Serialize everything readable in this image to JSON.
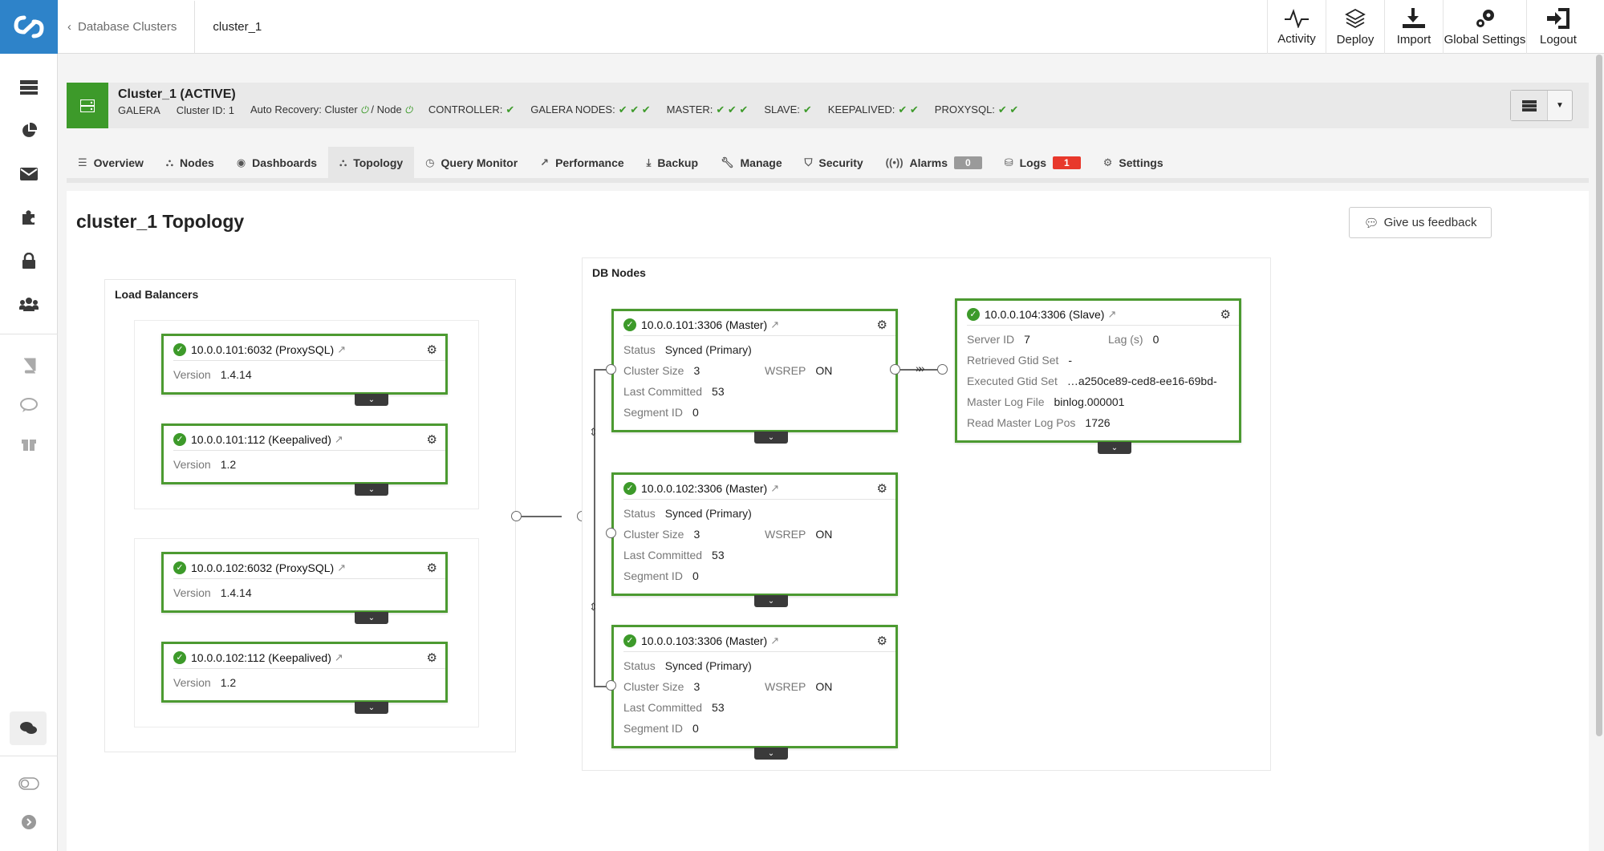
{
  "breadcrumb": {
    "back": "Database Clusters",
    "current": "cluster_1"
  },
  "toolbar": {
    "activity": "Activity",
    "deploy": "Deploy",
    "import": "Import",
    "global_settings": "Global Settings",
    "logout": "Logout"
  },
  "cluster": {
    "title": "Cluster_1 (ACTIVE)",
    "type": "GALERA",
    "cluster_id": "Cluster ID: 1",
    "auto_recovery": "Auto Recovery: Cluster",
    "node_sep": "/ Node",
    "controller": "CONTROLLER:",
    "galera_nodes": "GALERA NODES:",
    "master": "MASTER:",
    "slave": "SLAVE:",
    "keepalived": "KEEPALIVED:",
    "proxysql": "PROXYSQL:",
    "check1": "✔",
    "check2": "✔ ✔",
    "check3": "✔ ✔ ✔"
  },
  "tabs": [
    {
      "label": "Overview",
      "icon": "list-icon"
    },
    {
      "label": "Nodes",
      "icon": "sitemap-icon"
    },
    {
      "label": "Dashboards",
      "icon": "dashboard-icon"
    },
    {
      "label": "Topology",
      "icon": "topology-icon"
    },
    {
      "label": "Query Monitor",
      "icon": "clock-icon"
    },
    {
      "label": "Performance",
      "icon": "line-chart-icon"
    },
    {
      "label": "Backup",
      "icon": "download-icon"
    },
    {
      "label": "Manage",
      "icon": "wrench-icon"
    },
    {
      "label": "Security",
      "icon": "shield-icon"
    },
    {
      "label": "Alarms",
      "badge": "0",
      "icon": "broadcast-icon"
    },
    {
      "label": "Logs",
      "badge": "1",
      "icon": "archive-icon"
    },
    {
      "label": "Settings",
      "icon": "gear-icon"
    }
  ],
  "badges": {
    "alarms_color": "#9a9a9a",
    "logs_color": "#e8382b"
  },
  "page": {
    "title": "cluster_1 Topology",
    "feedback": "Give us feedback"
  },
  "groups": {
    "lb": "Load Balancers",
    "db": "DB Nodes"
  },
  "lbs": [
    {
      "title": "10.0.0.101:6032 (ProxySQL)",
      "k": "Version",
      "v": "1.4.14"
    },
    {
      "title": "10.0.0.101:112 (Keepalived)",
      "k": "Version",
      "v": "1.2"
    },
    {
      "title": "10.0.0.102:6032 (ProxySQL)",
      "k": "Version",
      "v": "1.4.14"
    },
    {
      "title": "10.0.0.102:112 (Keepalived)",
      "k": "Version",
      "v": "1.2"
    }
  ],
  "masters": [
    {
      "title": "10.0.0.101:3306 (Master)",
      "status_k": "Status",
      "status_v": "Synced (Primary)",
      "size_k": "Cluster Size",
      "size_v": "3",
      "wsrep_k": "WSREP",
      "wsrep_v": "ON",
      "lc_k": "Last Committed",
      "lc_v": "53",
      "seg_k": "Segment ID",
      "seg_v": "0"
    },
    {
      "title": "10.0.0.102:3306 (Master)",
      "status_k": "Status",
      "status_v": "Synced (Primary)",
      "size_k": "Cluster Size",
      "size_v": "3",
      "wsrep_k": "WSREP",
      "wsrep_v": "ON",
      "lc_k": "Last Committed",
      "lc_v": "53",
      "seg_k": "Segment ID",
      "seg_v": "0"
    },
    {
      "title": "10.0.0.103:3306 (Master)",
      "status_k": "Status",
      "status_v": "Synced (Primary)",
      "size_k": "Cluster Size",
      "size_v": "3",
      "wsrep_k": "WSREP",
      "wsrep_v": "ON",
      "lc_k": "Last Committed",
      "lc_v": "53",
      "seg_k": "Segment ID",
      "seg_v": "0"
    }
  ],
  "slave": {
    "title": "10.0.0.104:3306 (Slave)",
    "sid_k": "Server ID",
    "sid_v": "7",
    "lag_k": "Lag (s)",
    "lag_v": "0",
    "rgs_k": "Retrieved Gtid Set",
    "rgs_v": "-",
    "egs_k": "Executed Gtid Set",
    "egs_v": "…a250ce89-ced8-ee16-69bd-",
    "mlf_k": "Master Log File",
    "mlf_v": "binlog.000001",
    "rmlp_k": "Read Master Log Pos",
    "rmlp_v": "1726"
  }
}
